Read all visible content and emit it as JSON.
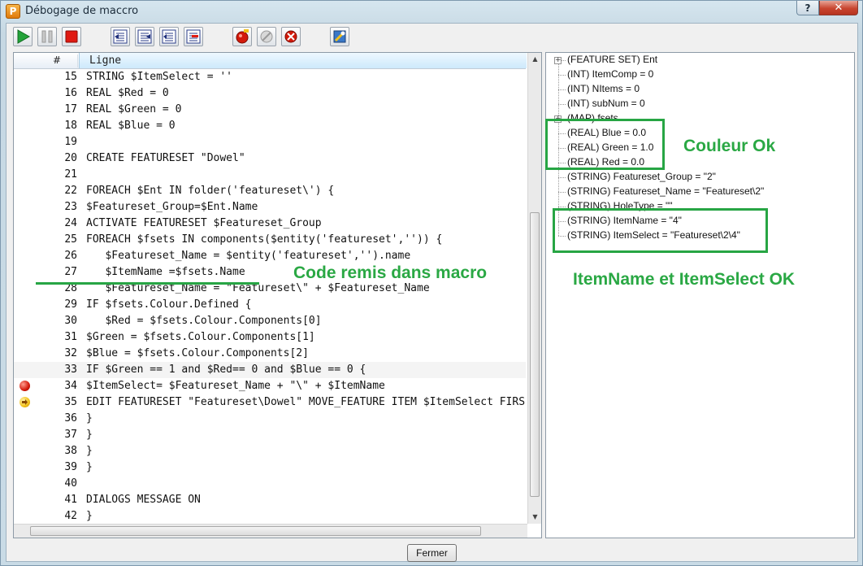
{
  "window": {
    "title": "Débogage de maccro",
    "app_icon_letter": "P",
    "help_label": "?",
    "close_label": "✕"
  },
  "toolbar": {
    "buttons": [
      {
        "name": "run-icon"
      },
      {
        "name": "pause-icon"
      },
      {
        "name": "stop-icon"
      },
      {
        "name": "step-into-icon"
      },
      {
        "name": "step-over-icon"
      },
      {
        "name": "step-out-icon"
      },
      {
        "name": "step-back-icon"
      },
      {
        "name": "breakpoint-add-icon"
      },
      {
        "name": "breakpoint-disable-icon"
      },
      {
        "name": "breakpoint-clear-icon"
      },
      {
        "name": "macro-tool-icon"
      }
    ]
  },
  "code_panel": {
    "header_number": "#",
    "header_line": "Ligne",
    "lines": [
      {
        "n": "15",
        "code": "STRING $ItemSelect = ''"
      },
      {
        "n": "16",
        "code": "REAL $Red = 0"
      },
      {
        "n": "17",
        "code": "REAL $Green = 0"
      },
      {
        "n": "18",
        "code": "REAL $Blue = 0"
      },
      {
        "n": "19",
        "code": ""
      },
      {
        "n": "20",
        "code": "CREATE FEATURESET \"Dowel\""
      },
      {
        "n": "21",
        "code": ""
      },
      {
        "n": "22",
        "code": "FOREACH $Ent IN folder('featureset\\') {"
      },
      {
        "n": "23",
        "code": "$Featureset_Group=$Ent.Name"
      },
      {
        "n": "24",
        "code": "ACTIVATE FEATURESET $Featureset_Group"
      },
      {
        "n": "25",
        "code": "FOREACH $fsets IN components($entity('featureset','')) {"
      },
      {
        "n": "26",
        "code": "   $Featureset_Name = $entity('featureset','').name"
      },
      {
        "n": "27",
        "code": "   $ItemName =$fsets.Name"
      },
      {
        "n": "28",
        "code": "   $Featureset_Name = \"Featureset\\\" + $Featureset_Name"
      },
      {
        "n": "29",
        "code": "IF $fsets.Colour.Defined {"
      },
      {
        "n": "30",
        "code": "   $Red = $fsets.Colour.Components[0]"
      },
      {
        "n": "31",
        "code": "$Green = $fsets.Colour.Components[1]"
      },
      {
        "n": "32",
        "code": "$Blue = $fsets.Colour.Components[2]"
      },
      {
        "n": "33",
        "code": "IF $Green == 1 and $Red== 0 and $Blue == 0 {"
      },
      {
        "n": "34",
        "code": "$ItemSelect= $Featureset_Name + \"\\\" + $ItemName"
      },
      {
        "n": "35",
        "code": "EDIT FEATURESET \"Featureset\\Dowel\" MOVE_FEATURE ITEM $ItemSelect FIRS"
      },
      {
        "n": "36",
        "code": "}"
      },
      {
        "n": "37",
        "code": "}"
      },
      {
        "n": "38",
        "code": "}"
      },
      {
        "n": "39",
        "code": "}"
      },
      {
        "n": "40",
        "code": ""
      },
      {
        "n": "41",
        "code": "DIALOGS MESSAGE ON"
      },
      {
        "n": "42",
        "code": "}"
      }
    ]
  },
  "variables": {
    "items": [
      {
        "label": "(FEATURE SET) Ent",
        "expander": "+"
      },
      {
        "label": "(INT) ItemComp = 0"
      },
      {
        "label": "(INT) NItems = 0"
      },
      {
        "label": "(INT) subNum = 0"
      },
      {
        "label": "(MAP) fsets",
        "expander": "+"
      },
      {
        "label": "(REAL) Blue = 0.0"
      },
      {
        "label": "(REAL) Green = 1.0"
      },
      {
        "label": "(REAL) Red = 0.0"
      },
      {
        "label": "(STRING) Featureset_Group = \"2\""
      },
      {
        "label": "(STRING) Featureset_Name = \"Featureset\\2\""
      },
      {
        "label": "(STRING) HoleType = \"\""
      },
      {
        "label": "(STRING) ItemName = \"4\""
      },
      {
        "label": "(STRING) ItemSelect = \"Featureset\\2\\4\""
      }
    ]
  },
  "annotations": {
    "code_note": "Code remis dans macro",
    "colour_note": "Couleur Ok",
    "item_note": "ItemName et ItemSelect OK"
  },
  "footer": {
    "close_label": "Fermer"
  },
  "colors": {
    "annotation_green": "#27a544",
    "breakpoint_red": "#d31a0b",
    "current_line_yellow": "#f2c019"
  }
}
